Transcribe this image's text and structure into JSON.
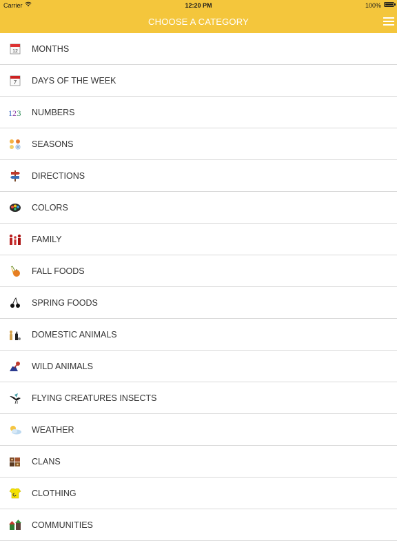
{
  "status_bar": {
    "carrier": "Carrier",
    "time": "12:20 PM",
    "battery": "100%"
  },
  "header": {
    "title": "CHOOSE A CATEGORY",
    "menu_icon": "hamburger-menu-icon",
    "background_color": "#f4c63c"
  },
  "categories": [
    {
      "label": "MONTHS",
      "icon": "calendar-icon"
    },
    {
      "label": "DAYS OF THE WEEK",
      "icon": "day-calendar-icon"
    },
    {
      "label": "NUMBERS",
      "icon": "numbers-icon"
    },
    {
      "label": "SEASONS",
      "icon": "seasons-icon"
    },
    {
      "label": "DIRECTIONS",
      "icon": "signpost-icon"
    },
    {
      "label": "COLORS",
      "icon": "paint-palette-icon"
    },
    {
      "label": "FAMILY",
      "icon": "family-icon"
    },
    {
      "label": "FALL FOODS",
      "icon": "pumpkin-corn-icon"
    },
    {
      "label": "SPRING FOODS",
      "icon": "cherries-icon"
    },
    {
      "label": "DOMESTIC ANIMALS",
      "icon": "dog-cat-icon"
    },
    {
      "label": "WILD ANIMALS",
      "icon": "wild-animals-icon"
    },
    {
      "label": "FLYING CREATURES INSECTS",
      "icon": "bird-icon"
    },
    {
      "label": "WEATHER",
      "icon": "sun-cloud-icon"
    },
    {
      "label": "CLANS",
      "icon": "clans-icon"
    },
    {
      "label": "CLOTHING",
      "icon": "shirt-icon"
    },
    {
      "label": "COMMUNITIES",
      "icon": "communities-icon"
    }
  ]
}
